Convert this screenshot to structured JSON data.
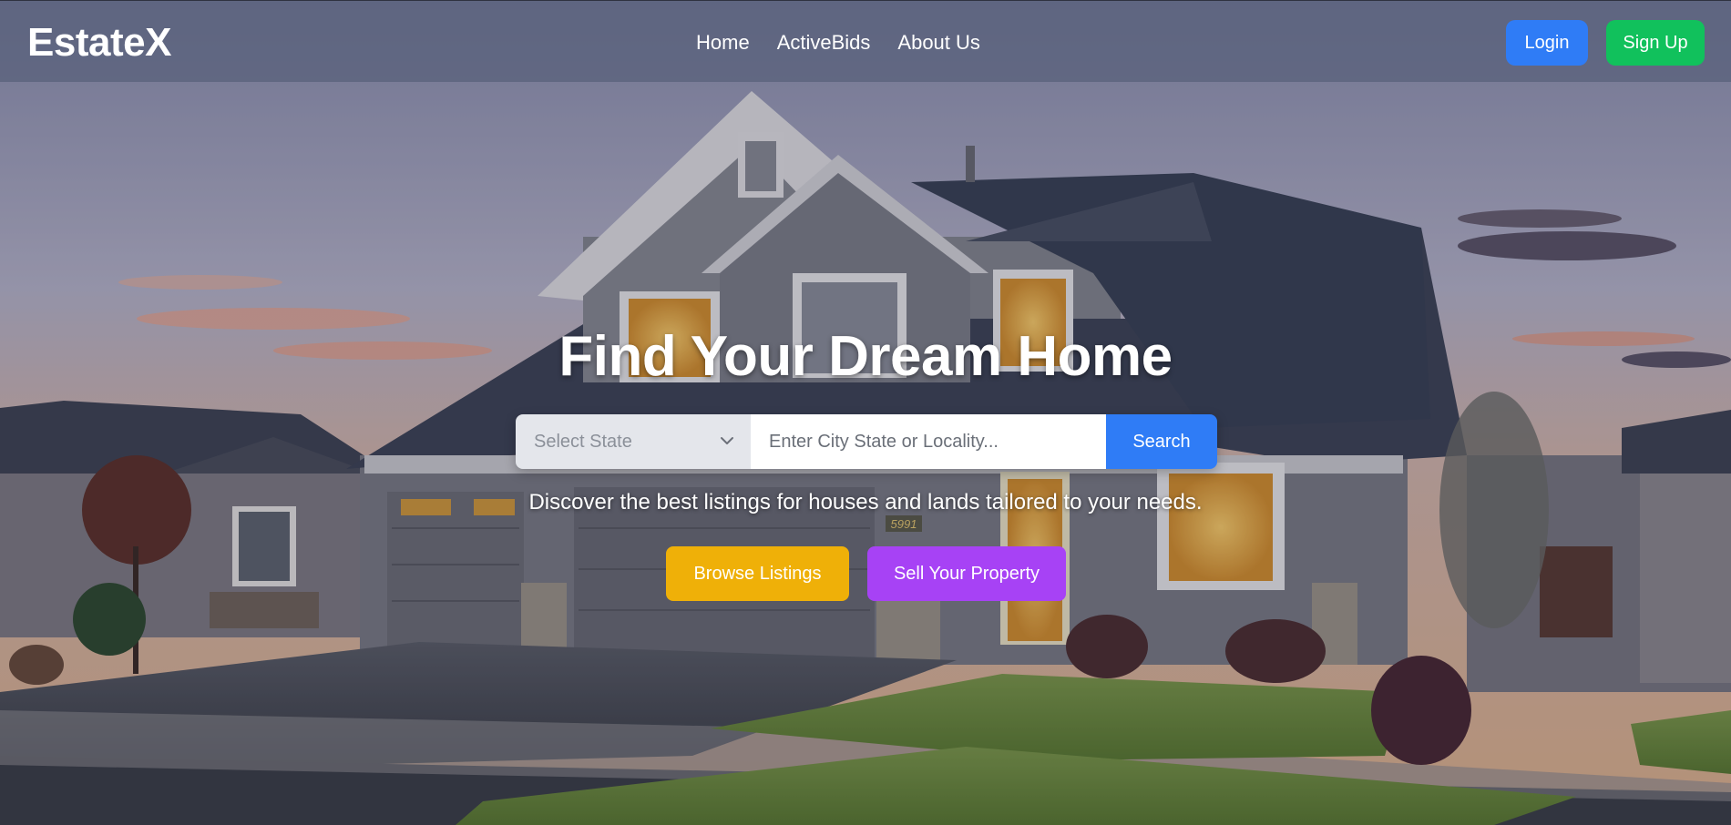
{
  "brand": {
    "logo": "EstateX"
  },
  "nav": {
    "links": [
      "Home",
      "ActiveBids",
      "About Us"
    ],
    "login_label": "Login",
    "signup_label": "Sign Up"
  },
  "hero": {
    "title": "Find Your Dream Home",
    "subtitle": "Discover the best listings for houses and lands tailored to your needs.",
    "search": {
      "state_placeholder": "Select State",
      "city_placeholder": "Enter City State or Locality...",
      "button_label": "Search"
    },
    "browse_label": "Browse Listings",
    "sell_label": "Sell Your Property",
    "background": {
      "image": "house-at-dusk-photo",
      "house_number": "5991"
    }
  },
  "colors": {
    "primary": "#2f7cf6",
    "success": "#11c15c",
    "warning": "#efb008",
    "purple": "#a742f5",
    "navbar": "#58607a"
  },
  "icons": {
    "select_arrow": "chevron-down-icon"
  }
}
